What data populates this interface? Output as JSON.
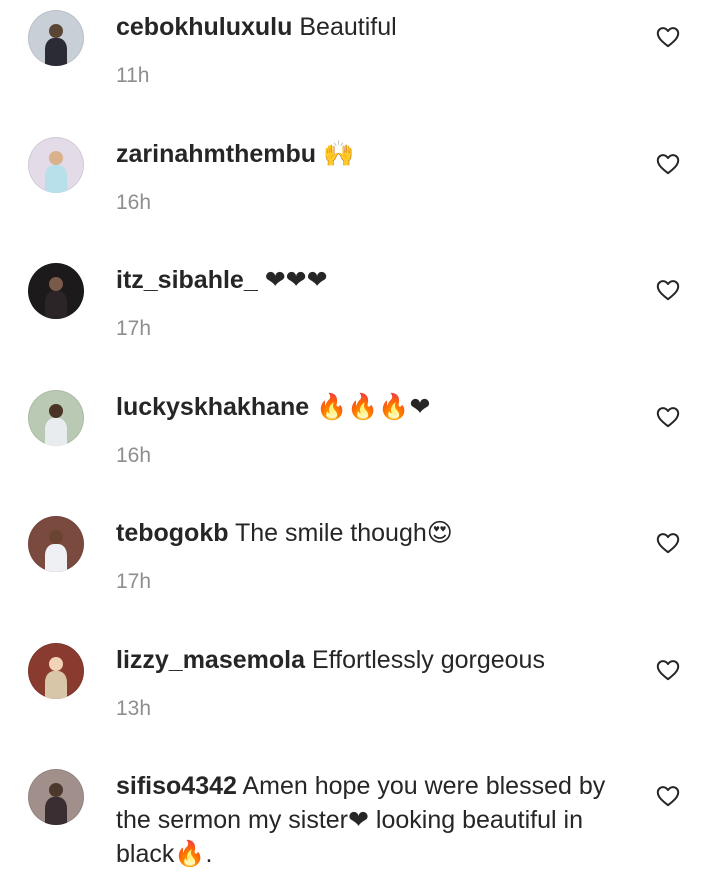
{
  "comments": [
    {
      "username": "cebokhuluxulu",
      "text": "Beautiful",
      "time": "11h",
      "avatar_bg": "#c9cfd6",
      "avatar_fig": "#2b2b33",
      "avatar_head": "#5a4634"
    },
    {
      "username": "zarinahmthembu",
      "text": "🙌",
      "time": "16h",
      "avatar_bg": "#e3dbe7",
      "avatar_fig": "#b8e0ea",
      "avatar_head": "#d9b28c"
    },
    {
      "username": "itz_sibahle_",
      "text": "❤❤❤",
      "time": "17h",
      "avatar_bg": "#1d1a1c",
      "avatar_fig": "#2c2528",
      "avatar_head": "#7a5a48"
    },
    {
      "username": "luckyskhakhane",
      "text": "🔥🔥🔥❤",
      "time": "16h",
      "avatar_bg": "#b9c9b3",
      "avatar_fig": "#e9ecef",
      "avatar_head": "#4a3427"
    },
    {
      "username": "tebogokb",
      "text": "The smile though😍",
      "time": "17h",
      "avatar_bg": "#7a4a3f",
      "avatar_fig": "#eef0f3",
      "avatar_head": "#6b4333"
    },
    {
      "username": "lizzy_masemola",
      "text": "Effortlessly gorgeous",
      "time": "13h",
      "avatar_bg": "#8a3b2f",
      "avatar_fig": "#d8c6a8",
      "avatar_head": "#f2d3b5"
    },
    {
      "username": "sifiso4342",
      "text": "Amen hope you were blessed by the sermon my sister❤ looking beautiful in black🔥.",
      "time": "",
      "avatar_bg": "#a08f8a",
      "avatar_fig": "#3b2e33",
      "avatar_head": "#4d382e"
    }
  ],
  "colors": {
    "text": "#262626",
    "secondary": "#8e8e8e",
    "heart_stroke": "#262626",
    "emoji_red": "#e0192a",
    "emoji_orange": "#f57d1f"
  },
  "icons": {
    "like": "heart-outline-icon"
  }
}
